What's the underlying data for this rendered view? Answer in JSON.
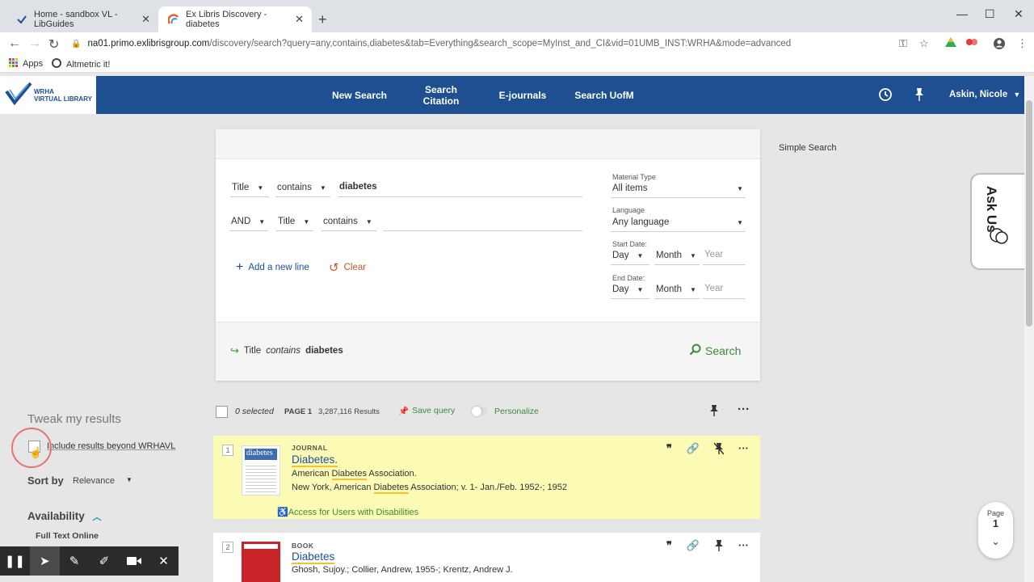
{
  "browser": {
    "tabs": [
      {
        "title": "Home - sandbox VL - LibGuides",
        "close": "✕"
      },
      {
        "title": "Ex Libris Discovery - diabetes",
        "close": "✕"
      }
    ],
    "new_tab": "+",
    "url_host": "na01.primo.exlibrisgroup.com",
    "url_path": "/discovery/search?query=any,contains,diabetes&tab=Everything&search_scope=MyInst_and_CI&vid=01UMB_INST:WRHA&mode=advanced",
    "bookmarks": [
      "Apps",
      "Altmetric it!"
    ]
  },
  "header": {
    "logo_line1": "WRHA",
    "logo_line2": "VIRTUAL LIBRARY",
    "nav": [
      "New Search",
      "Search Citation",
      "E-journals",
      "Search UofM"
    ],
    "user": "Askin, Nicole"
  },
  "advanced_search": {
    "row1": {
      "field": "Title",
      "operator": "contains",
      "value": "diabetes"
    },
    "row2": {
      "bool": "AND",
      "field": "Title",
      "operator": "contains",
      "value": ""
    },
    "add_line": "Add a new line",
    "clear": "Clear",
    "material_type_label": "Material Type",
    "material_type_value": "All items",
    "language_label": "Language",
    "language_value": "Any language",
    "start_date_label": "Start Date:",
    "end_date_label": "End Date:",
    "day": "Day",
    "month": "Month",
    "year_placeholder": "Year",
    "summary_field": "Title",
    "summary_op": "contains",
    "summary_value": "diabetes",
    "search_button": "Search"
  },
  "simple_search": "Simple Search",
  "ask_us": "Ask Us",
  "results_toolbar": {
    "selected": "0 selected",
    "page": "PAGE 1",
    "count": "3,287,116 Results",
    "save_query": "Save query",
    "personalize": "Personalize"
  },
  "facets": {
    "title": "Tweak my results",
    "include_beyond": "Include results beyond WRHAVL",
    "sort_by_label": "Sort by",
    "sort_by_value": "Relevance",
    "availability": "Availability",
    "full_text": "Full Text Online"
  },
  "results": [
    {
      "num": "1",
      "type": "JOURNAL",
      "title": "Diabetes.",
      "line1": "American Diabetes Association.",
      "line2": "New York, American Diabetes Association; v. 1- Jan./Feb. 1952-; 1952",
      "access": "Access for Users with Disabilities"
    },
    {
      "num": "2",
      "type": "BOOK",
      "title": "Diabetes",
      "line1": "Ghosh, Sujoy.; Collier, Andrew, 1955-; Krentz, Andrew J."
    }
  ],
  "page_indicator": {
    "label": "Page",
    "number": "1"
  }
}
